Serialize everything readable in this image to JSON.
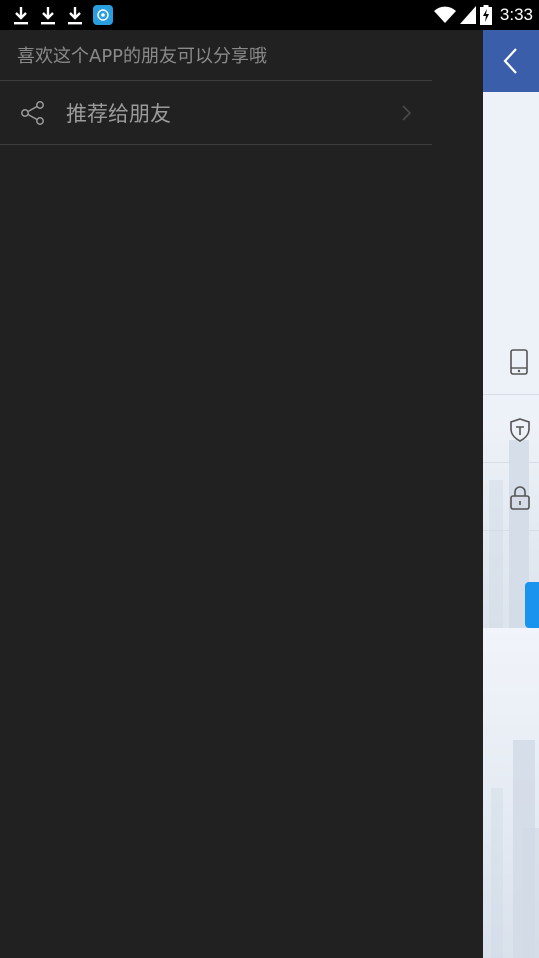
{
  "status_bar": {
    "time": "3:33",
    "left_icons": [
      "download-icon",
      "download-icon",
      "download-icon",
      "app-notification-icon"
    ],
    "right_icons": [
      "wifi-icon",
      "signal-icon",
      "battery-charging-icon"
    ]
  },
  "drawer": {
    "hint_text": "喜欢这个APP的朋友可以分享哦",
    "items": [
      {
        "label": "推荐给朋友",
        "icon": "share-icon"
      }
    ]
  },
  "background_page": {
    "header_icon": "back-icon",
    "row_icons": [
      "phone-icon",
      "shield-icon",
      "lock-icon"
    ],
    "accent_color": "#3b5eab",
    "button_color": "#1a93ef"
  },
  "colors": {
    "drawer_bg": "#212121",
    "divider": "#3d3d3d",
    "hint_text": "#8a8a8a",
    "item_text": "#9b9b9b"
  }
}
